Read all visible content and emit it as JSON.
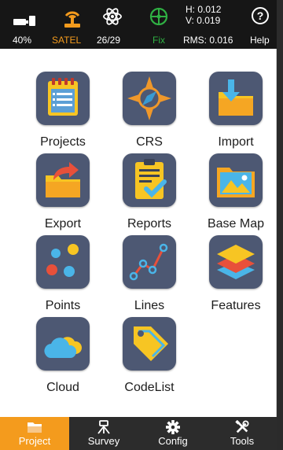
{
  "status": {
    "battery": {
      "icon": "battery-icon",
      "value": "40%"
    },
    "radio": {
      "icon": "radio-antenna-icon",
      "value": "SATEL",
      "color": "#f49b1d"
    },
    "satellites": {
      "icon": "satellite-icon",
      "value": "26/29"
    },
    "solution": {
      "icon": "crosshair-icon",
      "value": "Fix",
      "color": "#2fb043"
    },
    "precision": {
      "h": "H: 0.012",
      "v": "V: 0.019",
      "rms": "RMS: 0.016"
    },
    "help": {
      "icon": "help-icon",
      "glyph": "?",
      "label": "Help"
    }
  },
  "tiles": [
    {
      "label": "Projects",
      "icon": "notebook-icon"
    },
    {
      "label": "CRS",
      "icon": "compass-icon"
    },
    {
      "label": "Import",
      "icon": "folder-import-icon"
    },
    {
      "label": "Export",
      "icon": "folder-export-icon"
    },
    {
      "label": "Reports",
      "icon": "clipboard-check-icon"
    },
    {
      "label": "Base Map",
      "icon": "picture-folder-icon"
    },
    {
      "label": "Points",
      "icon": "points-icon"
    },
    {
      "label": "Lines",
      "icon": "polyline-icon"
    },
    {
      "label": "Features",
      "icon": "layers-icon"
    },
    {
      "label": "Cloud",
      "icon": "cloud-icon"
    },
    {
      "label": "CodeList",
      "icon": "tag-icon"
    }
  ],
  "nav": [
    {
      "label": "Project",
      "icon": "folder-icon",
      "active": true
    },
    {
      "label": "Survey",
      "icon": "tripod-icon",
      "active": false
    },
    {
      "label": "Config",
      "icon": "gear-icon",
      "active": false
    },
    {
      "label": "Tools",
      "icon": "tools-icon",
      "active": false
    }
  ],
  "colors": {
    "accent": "#f49b1d",
    "fix": "#2fb043",
    "tile_bg": "#4d5873",
    "status_bg": "#161616",
    "nav_bg": "#2c2c2c"
  }
}
